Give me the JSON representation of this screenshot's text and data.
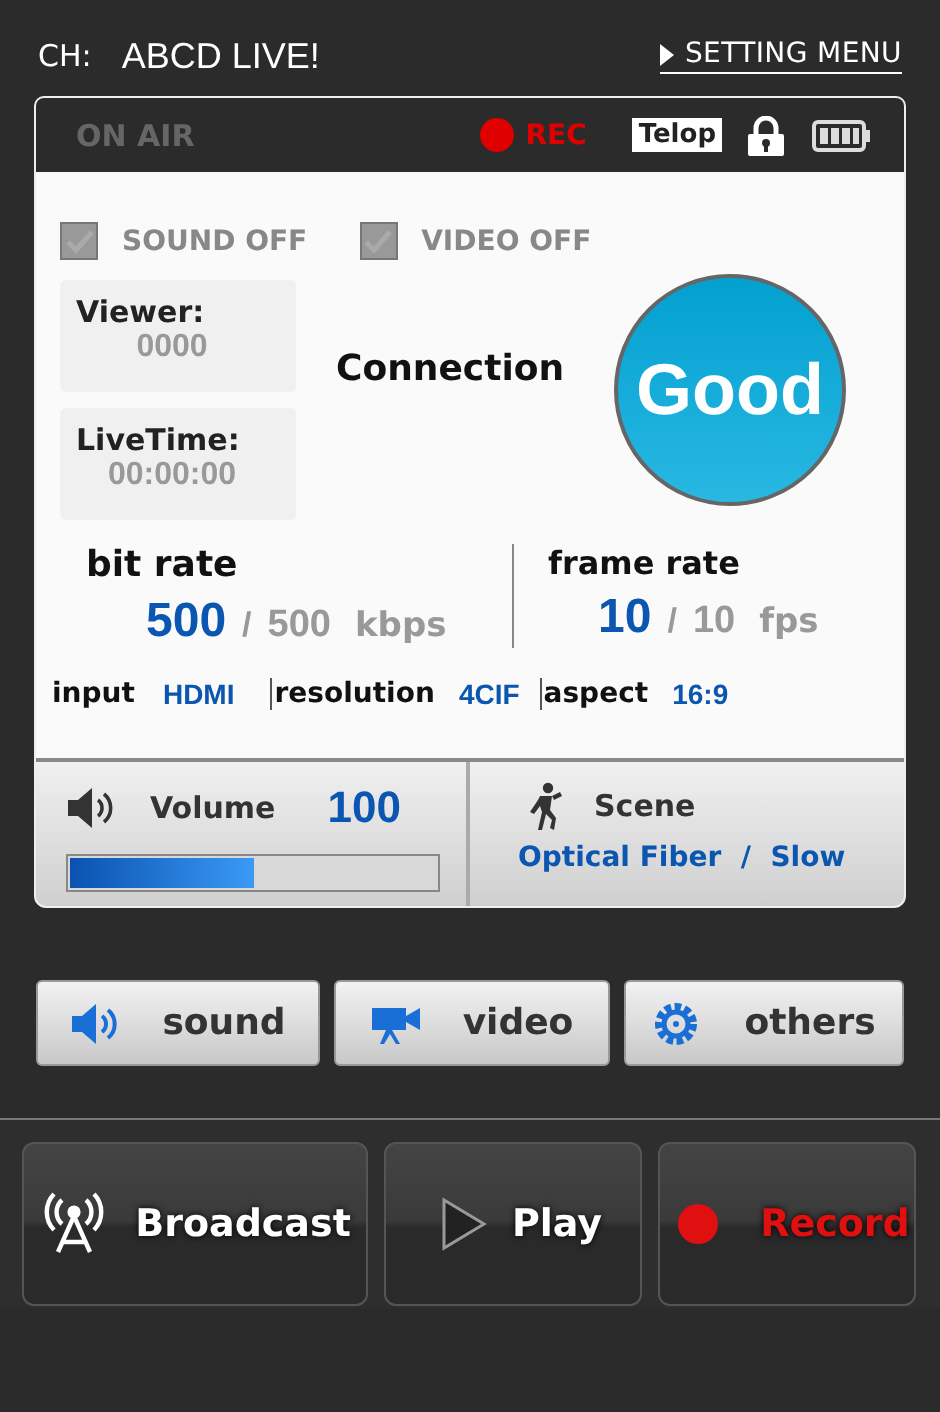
{
  "header": {
    "channel_label": "CH:",
    "channel_name": "ABCD LIVE!",
    "setting_link": "SETTING MENU"
  },
  "status_bar": {
    "on_air": "ON AIR",
    "rec": "REC",
    "telop": "Telop"
  },
  "toggles": [
    {
      "label": "SOUND OFF",
      "checked": true
    },
    {
      "label": "VIDEO OFF",
      "checked": true
    }
  ],
  "viewer": {
    "label": "Viewer:",
    "value": "0000"
  },
  "live_time": {
    "label": "LiveTime:",
    "value": "00:00:00"
  },
  "connection": {
    "label": "Connection",
    "status": "Good"
  },
  "bit_rate": {
    "label": "bit rate",
    "current": "500",
    "separator": "/",
    "max": "500",
    "unit": "kbps"
  },
  "frame_rate": {
    "label": "frame rate",
    "current": "10",
    "separator": "/",
    "max": "10",
    "unit": "fps"
  },
  "specs": [
    {
      "label": "input",
      "value": "HDMI"
    },
    {
      "label": "resolution",
      "value": "4CIF"
    },
    {
      "label": "aspect",
      "value": "16:9"
    }
  ],
  "volume": {
    "label": "Volume",
    "value": "100",
    "level": 0.5
  },
  "scene": {
    "label": "Scene",
    "value": "Optical Fiber  /  Slow"
  },
  "tabs": [
    {
      "kind": "sound",
      "label": "sound"
    },
    {
      "kind": "video",
      "label": "video"
    },
    {
      "kind": "others",
      "label": "others"
    }
  ],
  "actions": [
    {
      "kind": "broadcast",
      "label": "Broadcast"
    },
    {
      "kind": "play",
      "label": "Play"
    },
    {
      "kind": "record",
      "label": "Record"
    }
  ]
}
